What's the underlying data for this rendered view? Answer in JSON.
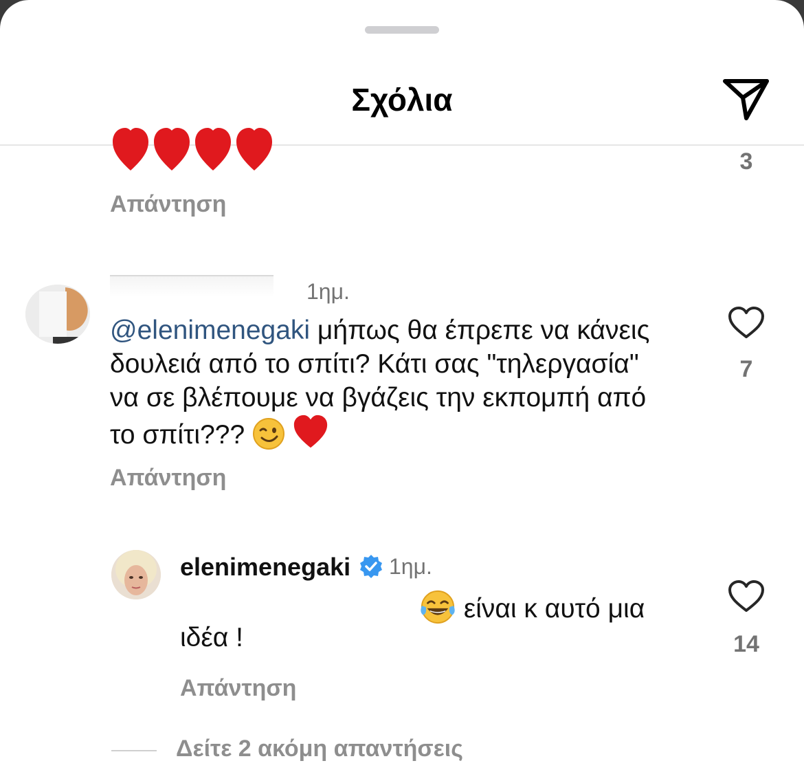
{
  "header": {
    "title": "Σχόλια",
    "share_icon": "paper-plane-icon"
  },
  "comments": [
    {
      "text_emoji": "❤️❤️❤️❤️",
      "likes": "3",
      "reply_label": "Απάντηση"
    },
    {
      "time": "1ημ.",
      "mention": "@elenimenegaki",
      "text": " μήπως θα έπρεπε να κάνεις δουλειά από το σπίτι? Κάτι σας \"τηλεργασία\" να σε βλέπουμε να βγάζεις την εκπομπή από το σπίτι???",
      "likes": "7",
      "reply_label": "Απάντηση"
    }
  ],
  "reply": {
    "username": "elenimenegaki",
    "time": "1ημ.",
    "text_line1": " είναι κ αυτό μια",
    "text_line2": "ιδέα !",
    "likes": "14",
    "reply_label": "Απάντηση"
  },
  "view_more": "Δείτε 2 ακόμη απαντήσεις",
  "colors": {
    "mention": "#30557f",
    "verified": "#3897f0",
    "heart_red": "#e0191e"
  }
}
